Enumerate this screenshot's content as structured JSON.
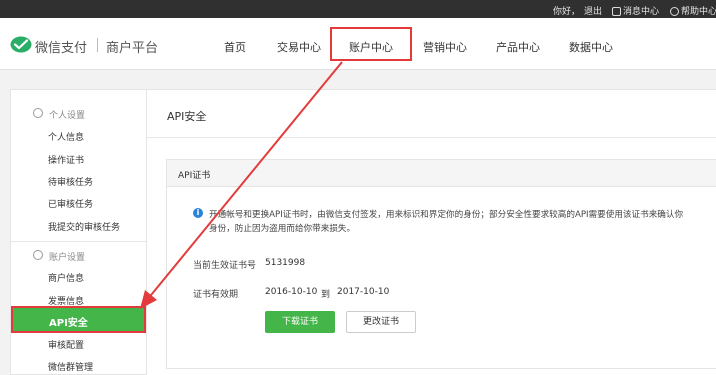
{
  "topbar": {
    "greeting": "你好，",
    "logout": "退出",
    "messages": "消息中心",
    "help": "帮助中心"
  },
  "header": {
    "brand": "微信支付",
    "platform": "商户平台",
    "nav": [
      "首页",
      "交易中心",
      "账户中心",
      "营销中心",
      "产品中心",
      "数据中心"
    ],
    "active_nav": "账户中心"
  },
  "sidebar": {
    "personal_title": "个人设置",
    "personal_items": [
      "个人信息",
      "操作证书",
      "待审核任务",
      "已审核任务",
      "我提交的审核任务"
    ],
    "account_title": "账户设置",
    "account_items": [
      "商户信息",
      "发票信息",
      "API安全",
      "审核配置",
      "微信群管理"
    ],
    "active_item": "API安全"
  },
  "main": {
    "title": "API安全",
    "card_title": "API证书",
    "notice_line1": "开通帐号和更换API证书时，由微信支付签发，用来标识和界定你的身份；部分安全性要求较高的API需要使用该证书来确认你",
    "notice_line2": "身份，防止因为盗用而给你带来损失。",
    "cert_no_label": "当前生效证书号",
    "cert_no": "5131998",
    "validity_label": "证书有效期",
    "valid_from": "2016-10-10",
    "valid_to_sep": "到",
    "valid_to": "2017-10-10",
    "download_button": "下载证书",
    "change_button": "更改证书"
  },
  "colors": {
    "brand_green": "#44b549",
    "highlight_red": "#e33b3b",
    "topbar_bg": "#303030"
  },
  "icons": [
    "wechat-pay-logo-icon",
    "message-icon",
    "help-icon",
    "user-icon",
    "gear-icon",
    "info-icon"
  ]
}
